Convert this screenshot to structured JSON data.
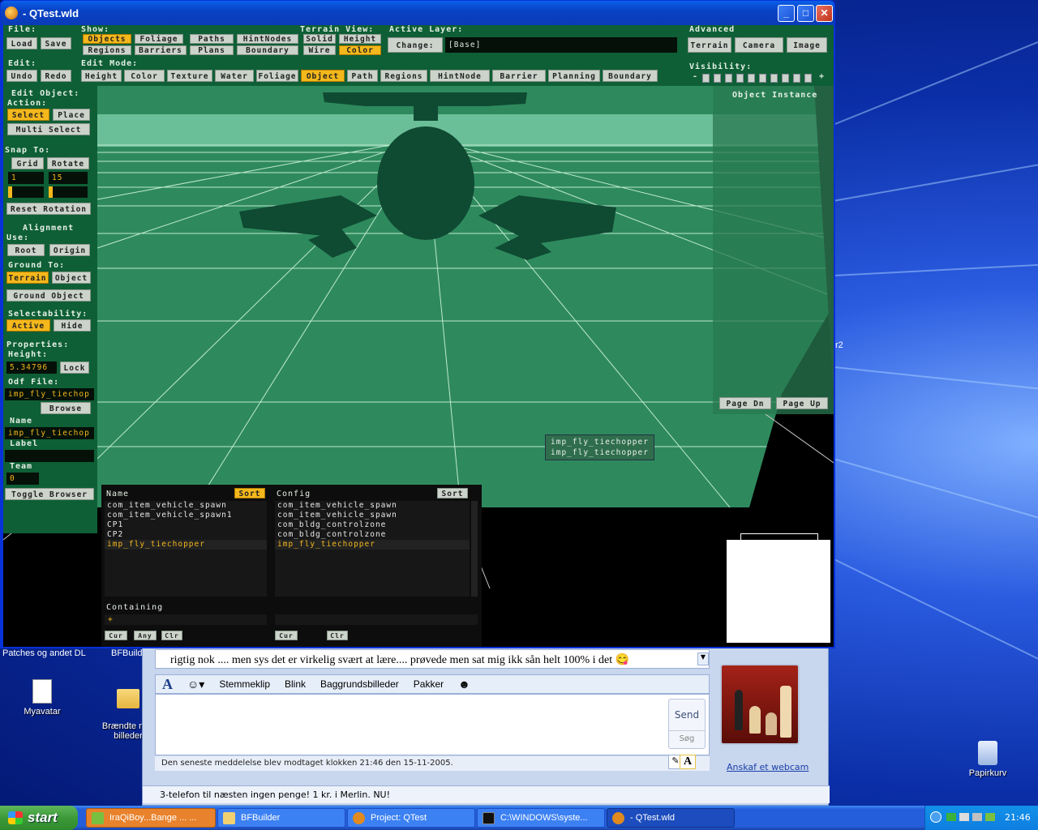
{
  "desktop": {
    "icons": [
      {
        "label": "Myavatar"
      },
      {
        "label": "Brændte mar\nbilleder"
      },
      {
        "label": "Papirkurv"
      }
    ],
    "partial_labels": {
      "patches": "Patches og andet DL",
      "bfbuilder": "BFBuilde",
      "r2": "r2"
    }
  },
  "window": {
    "title": "- QTest.wld",
    "controls": {
      "min": "_",
      "max": "□",
      "close": "✕"
    }
  },
  "top": {
    "file_label": "File:",
    "load": "Load",
    "save": "Save",
    "edit_label": "Edit:",
    "undo": "Undo",
    "redo": "Redo",
    "show_label": "Show:",
    "show_items": [
      {
        "label": "Objects",
        "active": true
      },
      {
        "label": "Foliage",
        "active": false
      },
      {
        "label": "Paths",
        "active": false
      },
      {
        "label": "HintNodes",
        "active": false
      },
      {
        "label": "Regions",
        "active": false
      },
      {
        "label": "Barriers",
        "active": false
      },
      {
        "label": "Plans",
        "active": false
      },
      {
        "label": "Boundary",
        "active": false
      }
    ],
    "terrain_view_label": "Terrain View:",
    "terrain_view": [
      {
        "label": "Solid",
        "active": false
      },
      {
        "label": "Height",
        "active": false
      },
      {
        "label": "Wire",
        "active": false
      },
      {
        "label": "Color",
        "active": true
      }
    ],
    "active_layer_label": "Active Layer:",
    "change": "Change:",
    "layer_value": "[Base]",
    "advanced_label": "Advanced",
    "terrain": "Terrain",
    "camera": "Camera",
    "image": "Image",
    "visibility_label": "Visibility:",
    "vis_minus": "-",
    "vis_plus": "+",
    "edit_mode_label": "Edit Mode:",
    "edit_modes": [
      {
        "label": "Height",
        "active": false
      },
      {
        "label": "Color",
        "active": false
      },
      {
        "label": "Texture",
        "active": false
      },
      {
        "label": "Water",
        "active": false
      },
      {
        "label": "Foliage",
        "active": false
      },
      {
        "label": "Object",
        "active": true
      },
      {
        "label": "Path",
        "active": false
      },
      {
        "label": "Regions",
        "active": false
      },
      {
        "label": "HintNode",
        "active": false
      },
      {
        "label": "Barrier",
        "active": false
      },
      {
        "label": "Planning",
        "active": false
      },
      {
        "label": "Boundary",
        "active": false
      }
    ]
  },
  "left": {
    "edit_object": "Edit Object:",
    "action": "Action:",
    "select": "Select",
    "place": "Place",
    "multi_select": "Multi Select",
    "snap_to": "Snap To:",
    "grid": "Grid",
    "rotate": "Rotate",
    "grid_val": "1",
    "rotate_val": "15",
    "reset_rotation": "Reset Rotation",
    "alignment": "Alignment",
    "use": "Use:",
    "root": "Root",
    "origin": "Origin",
    "ground_to": "Ground To:",
    "terrain": "Terrain",
    "object": "Object",
    "ground_object": "Ground Object",
    "selectability": "Selectability:",
    "active": "Active",
    "hide": "Hide",
    "properties": "Properties:",
    "height": "Height:",
    "height_val": "5.34796",
    "lock": "Lock",
    "odf_file": "Odf File:",
    "odf_val": "imp_fly_tiechop",
    "browse": "Browse",
    "name": "Name",
    "name_val": "imp_fly_tiechop",
    "label": "Label",
    "label_val": "",
    "team": "Team",
    "team_val": "0",
    "toggle_browser": "Toggle Browser"
  },
  "object_instance": {
    "title": "Object Instance",
    "page_dn": "Page Dn",
    "page_up": "Page Up"
  },
  "viewport": {
    "tag_lines": [
      "imp_fly_tiechopper",
      "imp_fly_tiechopper"
    ]
  },
  "browser": {
    "name_header": "Name",
    "config_header": "Config",
    "sort": "Sort",
    "names": [
      "com_item_vehicle_spawn",
      "com_item_vehicle_spawn1",
      "CP1",
      "CP2",
      "imp_fly_tiechopper"
    ],
    "configs": [
      "com_item_vehicle_spawn",
      "com_item_vehicle_spawn",
      "com_bldg_controlzone",
      "com_bldg_controlzone",
      "imp_fly_tiechopper"
    ],
    "selected_index": 4,
    "containing": "Containing",
    "containing_val": "+",
    "cur": "Cur",
    "any": "Any",
    "clr": "Clr"
  },
  "messenger": {
    "message": "rigtig nok .... men sys det er virkelig svært at lære.... prøvede men sat mig ikk sån helt 100% i det 😋",
    "toolbar": [
      "Stemmeklip",
      "Blink",
      "Baggrundsbilleder",
      "Pakker"
    ],
    "send": "Send",
    "search": "Søg",
    "status": "Den seneste meddelelse blev modtaget klokken 21:46 den 15-11-2005.",
    "webcam": "Anskaf et webcam",
    "footer": "3-telefon til næsten ingen penge! 1 kr. i Merlin. NU!"
  },
  "taskbar": {
    "start": "start",
    "tasks": [
      "IraQiBoy...Bange ... ...",
      "BFBuilder",
      "Project: QTest",
      "C:\\WINDOWS\\syste...",
      "- QTest.wld"
    ],
    "clock": "21:46"
  }
}
